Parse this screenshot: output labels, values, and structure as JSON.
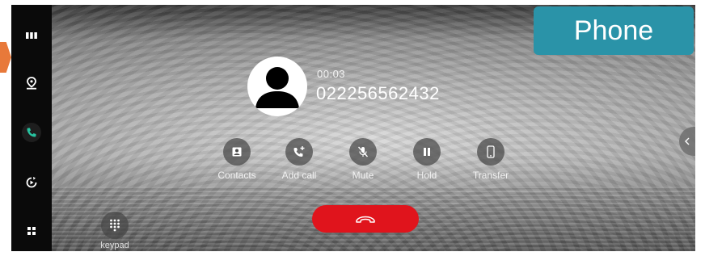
{
  "header": {
    "app_badge": "Phone"
  },
  "sidebar": {
    "items": [
      {
        "icon": "apps-grid-icon",
        "active": false
      },
      {
        "icon": "map-pin-icon",
        "active": false
      },
      {
        "icon": "phone-icon",
        "active": true
      },
      {
        "icon": "media-icon",
        "active": false
      },
      {
        "icon": "home-grid-icon",
        "active": false
      }
    ]
  },
  "call": {
    "duration": "00:03",
    "number": "022256562432"
  },
  "actions": [
    {
      "label": "Contacts",
      "icon": "contacts-icon"
    },
    {
      "label": "Add call",
      "icon": "add-call-icon"
    },
    {
      "label": "Mute",
      "icon": "mute-icon"
    },
    {
      "label": "Hold",
      "icon": "pause-icon"
    },
    {
      "label": "Transfer",
      "icon": "transfer-phone-icon"
    }
  ],
  "keypad": {
    "label": "keypad"
  },
  "colors": {
    "end_call": "#e0141c",
    "badge": "#2a93a8",
    "active_icon": "#27c3a0",
    "pointer": "#e8793a"
  }
}
